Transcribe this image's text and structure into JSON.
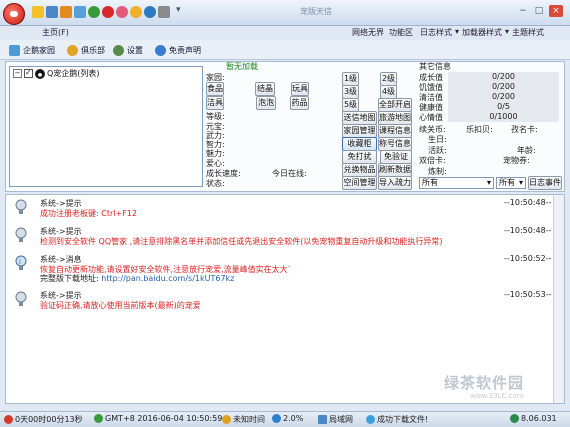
{
  "window": {
    "title": "宠版天信",
    "controls": [
      "−",
      "□",
      "×"
    ],
    "version": "8.06.031"
  },
  "menus": [
    "主页(F)",
    "网络无界",
    "功能区",
    "日志样式",
    "加载器样式",
    "主题样式"
  ],
  "toolbar": [
    {
      "label": "企鹅家园",
      "icon": "home-icon"
    },
    {
      "label": "俱乐部",
      "icon": "club-icon"
    },
    {
      "label": "设置",
      "icon": "gear-icon"
    },
    {
      "label": "免责声明",
      "icon": "disclaimer-icon"
    }
  ],
  "tree": {
    "item_label": "Q宠企鹅(列表)"
  },
  "status_header": "暂无加载",
  "left_fields": {
    "jiating": "家园:",
    "dengji": "等级:",
    "yuanbao": "元宝:",
    "wuli": "武力:",
    "zhili": "智力:",
    "meili": "魅力:",
    "aixin": "爱心:",
    "chengzhang": "成长速度:",
    "jinri": "今日在线:",
    "zhuangtai": "状态:"
  },
  "food_buttons": [
    "食品",
    "结晶",
    "玩具",
    "洁具",
    "泡泡",
    "药品"
  ],
  "level_buttons": [
    "1级",
    "2级",
    "3级",
    "4级",
    "5级",
    "全部开启"
  ],
  "action_buttons": [
    [
      "送信地图",
      "旅游地图"
    ],
    [
      "家园管理",
      "课程信息"
    ],
    [
      "收藏柜",
      "称号信息"
    ],
    [
      "免打扰",
      "免验证"
    ],
    [
      "兑换物品",
      "刷新数据"
    ],
    [
      "空间管理",
      "导入疏力"
    ]
  ],
  "other_info": {
    "title": "其它信息",
    "rows": [
      {
        "label": "成长值",
        "value": "0/200"
      },
      {
        "label": "饥饿值",
        "value": "0/200"
      },
      {
        "label": "清洁值",
        "value": "0/200"
      },
      {
        "label": "健康值",
        "value": "0/5"
      },
      {
        "label": "心情值",
        "value": "0/1000"
      }
    ],
    "family": "续关币:",
    "club": "乐扣贝:",
    "qq": "孜名卡:",
    "birthday": "生日:",
    "activity": "活跃:",
    "age": "年龄:",
    "zhuangtai": "双倍卡:",
    "pet": "宠物券:",
    "caozuo": "炼制:"
  },
  "filters": {
    "select1": "所有",
    "select2": "所有",
    "log_button": "日志事件"
  },
  "messages": [
    {
      "from": "系统->提示",
      "time": "--10:50:48--",
      "line1": "成功注册老板键: Ctrl+F12",
      "line1_color": "red"
    },
    {
      "from": "系统->提示",
      "time": "--10:50:48--",
      "line1": "检测到安全软件 QQ管家 ,请注意排除黑名单并添加信任或先退出安全软件(以免宠物重复自动升级和功能执行异常)",
      "line1_color": "red"
    },
    {
      "from": "系统->消息",
      "time": "--10:50:52--",
      "line1": "恢复自动更新功能,请设置好安全软件,注意放行宠爱,流量峰值实在太大了...",
      "line2_prefix": "完整版下载地址: ",
      "line2_link": "http://pan.baidu.com/s/1kUT67kz"
    },
    {
      "from": "系统->提示",
      "time": "--10:50:53--",
      "line1": "验证码正确,请放心使用当前版本(最新)的宠爱",
      "line1_color": "red"
    }
  ],
  "statusbar": {
    "online": "0天00时00分13秒",
    "datetime": "GMT+8 2016-06-04 10:50:59",
    "unknown": "未知时间",
    "cpu": "2.0%",
    "net": "局域网",
    "download": "成功下载文件!",
    "version": "8.06.031"
  },
  "watermark": {
    "text": "绿茶软件园",
    "url": "www.33LC.com"
  },
  "colors": {
    "accent": "#3d6ea5",
    "red_text": "#dd2222",
    "link": "#2a5fb0",
    "green_text": "#1a8a1a"
  }
}
